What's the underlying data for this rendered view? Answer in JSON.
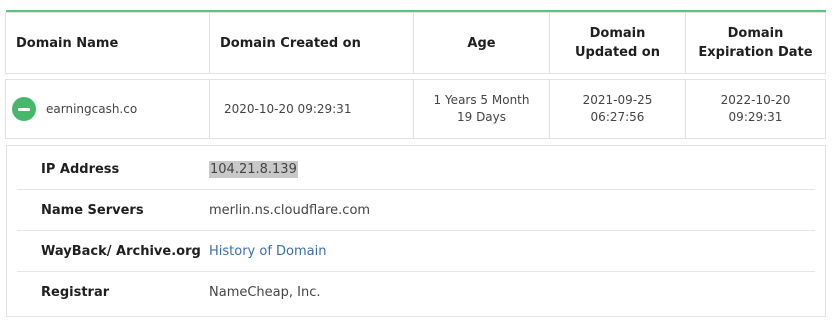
{
  "table": {
    "headers": [
      "Domain Name",
      "Domain Created on",
      "Age",
      "Domain Updated on",
      "Domain Expiration Date"
    ],
    "row": {
      "domain": "earningcash.co",
      "created": "2020-10-20 09:29:31",
      "age": "1 Years 5 Month 19 Days",
      "updated": "2021-09-25 06:27:56",
      "expires": "2022-10-20 09:29:31"
    }
  },
  "details": {
    "ip_label": "IP Address",
    "ip_value": "104.21.8.139",
    "ns_label": "Name Servers",
    "ns_value": "merlin.ns.cloudflare.com",
    "wayback_label": "WayBack/ Archive.org",
    "wayback_value": "History of Domain",
    "registrar_label": "Registrar",
    "registrar_value": "NameCheap, Inc."
  },
  "colors": {
    "accent": "#5ec27c",
    "toggle": "#45b86a",
    "link": "#3b6ea8"
  },
  "icons": {
    "toggle": "minus-circle-icon"
  }
}
